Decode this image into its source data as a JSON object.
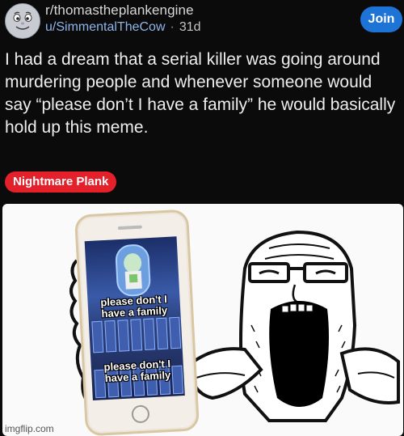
{
  "post": {
    "subreddit": "r/thomastheplankengine",
    "username": "u/SimmentalTheCow",
    "separator": "·",
    "age": "31d",
    "join_label": "Join",
    "title": "I had a dream that a serial killer was going around murdering people and whenever someone would say “please don’t I have a family” he would basically hold up this meme.",
    "flair": "Nightmare Plank"
  },
  "meme": {
    "caption_top": "please don't I have a family",
    "caption_bottom": "please don't I have a family",
    "watermark": "imgflip.com"
  },
  "colors": {
    "background": "#0b0b0c",
    "join_button": "#1e74d6",
    "flair": "#e4202b",
    "username": "#8fb5e8"
  },
  "icons": {
    "avatar": "thomas-face-avatar"
  }
}
